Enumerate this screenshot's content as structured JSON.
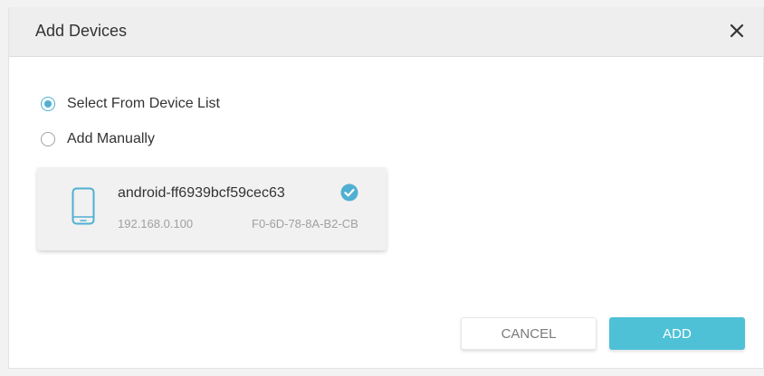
{
  "dialog": {
    "title": "Add Devices"
  },
  "options": [
    {
      "label": "Select From Device List",
      "selected": true
    },
    {
      "label": "Add Manually",
      "selected": false
    }
  ],
  "device": {
    "name": "android-ff6939bcf59cec63",
    "ip": "192.168.0.100",
    "mac": "F0-6D-78-8A-B2-CB",
    "selected": true,
    "icon": "phone-icon"
  },
  "buttons": {
    "cancel_label": "CANCEL",
    "add_label": "ADD"
  },
  "colors": {
    "accent": "#4fb0d2",
    "add_button": "#4fc1d7",
    "header_bg": "#eeeeee"
  }
}
